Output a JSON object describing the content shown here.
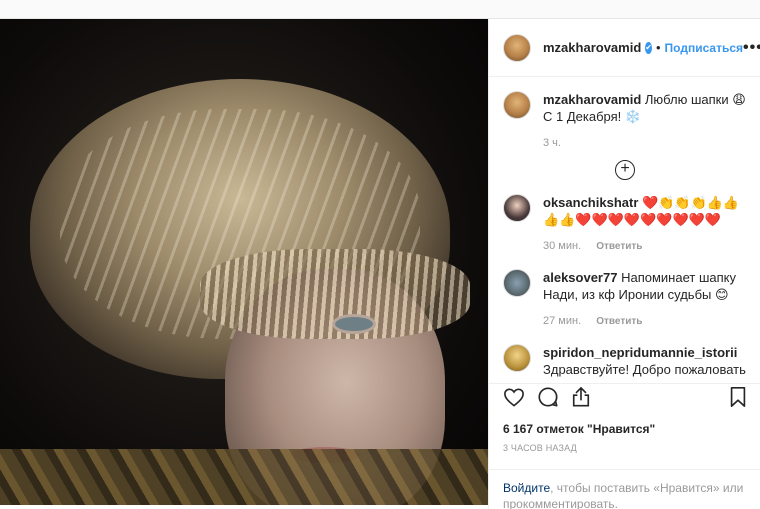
{
  "post": {
    "username": "mzakharovamid",
    "verified_mark": "✔",
    "follow_separator": "•",
    "follow_label": "Подписаться",
    "more_label": "•••"
  },
  "caption": {
    "username": "mzakharovamid",
    "text": "Люблю шапки 😩 С 1 Декабря! ❄️",
    "time": "3 ч."
  },
  "load_more_icon": "plus-circle-icon",
  "comments": [
    {
      "username": "oksanchikshatr",
      "text": "❤️👏👏👏👍👍👍👍❤️❤️❤️❤️❤️❤️❤️❤️❤️",
      "time": "30 мин.",
      "reply": "Ответить"
    },
    {
      "username": "aleksover77",
      "text": "Напоминает шапку Нади, из кф Иронии судьбы 😊",
      "time": "27 мин.",
      "reply": "Ответить"
    },
    {
      "username": "spiridon_nepridumannie_istorii",
      "text": "Здравствуйте! Добро пожаловать на",
      "time": "",
      "reply": ""
    }
  ],
  "actions": {
    "like_icon": "heart-icon",
    "comment_icon": "comment-icon",
    "share_icon": "share-icon",
    "save_icon": "bookmark-icon"
  },
  "likes_text": "6 167 отметок \"Нравится\"",
  "posted_ago": "3 ЧАСОВ НАЗАД",
  "login": {
    "link": "Войдите",
    "rest": ", чтобы поставить «Нравится» или прокомментировать."
  }
}
